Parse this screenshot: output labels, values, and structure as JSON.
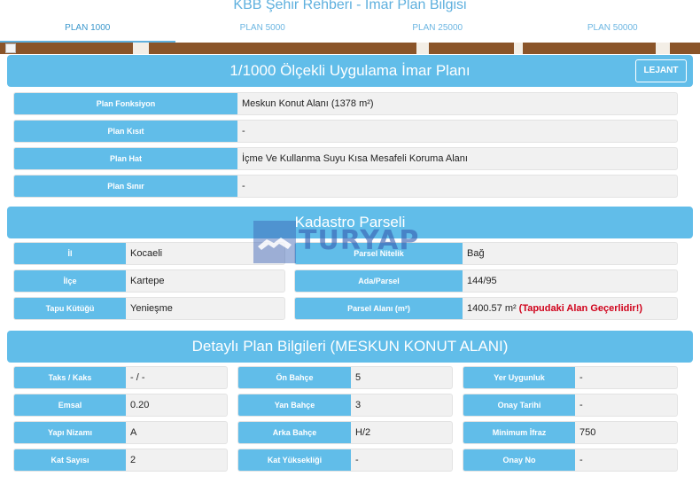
{
  "title": "KBB Şehir Rehberi - İmar Plan Bilgisi",
  "tabs": [
    "PLAN 1000",
    "PLAN 5000",
    "PLAN 25000",
    "PLAN 50000"
  ],
  "plan_section": {
    "title": "1/1000 Ölçekli Uygulama İmar Planı",
    "legend_button": "LEJANT",
    "rows": [
      {
        "label": "Plan Fonksiyon",
        "value": "Meskun Konut Alanı (1378 m²)"
      },
      {
        "label": "Plan Kısıt",
        "value": "-"
      },
      {
        "label": "Plan Hat",
        "value": "İçme Ve Kullanma Suyu Kısa Mesafeli Koruma Alanı"
      },
      {
        "label": "Plan Sınır",
        "value": "-"
      }
    ]
  },
  "cadastre_section": {
    "title": "Kadastro Parseli",
    "left": [
      {
        "label": "İl",
        "value": "Kocaeli"
      },
      {
        "label": "İlçe",
        "value": "Kartepe"
      },
      {
        "label": "Tapu Kütüğü",
        "value": "Yenieşme"
      }
    ],
    "right": [
      {
        "label": "Parsel Nitelik",
        "value": "Bağ"
      },
      {
        "label": "Ada/Parsel",
        "value": "144/95"
      },
      {
        "label": "Parsel Alanı (m²)",
        "value": "1400.57 m²",
        "note": "(Tapudaki Alan Geçerlidir!)"
      }
    ]
  },
  "detail_section": {
    "title": "Detaylı Plan Bilgileri (MESKUN KONUT ALANI)",
    "col1": [
      {
        "label": "Taks / Kaks",
        "value": "- / -"
      },
      {
        "label": "Emsal",
        "value": "0.20"
      },
      {
        "label": "Yapı Nizamı",
        "value": "A"
      },
      {
        "label": "Kat Sayısı",
        "value": "2"
      }
    ],
    "col2": [
      {
        "label": "Ön Bahçe",
        "value": "5"
      },
      {
        "label": "Yan Bahçe",
        "value": "3"
      },
      {
        "label": "Arka Bahçe",
        "value": "H/2"
      },
      {
        "label": "Kat Yüksekliği",
        "value": "-"
      }
    ],
    "col3": [
      {
        "label": "Yer Uygunluk",
        "value": "-"
      },
      {
        "label": "Onay Tarihi",
        "value": "-"
      },
      {
        "label": "Minimum İfraz",
        "value": "750"
      },
      {
        "label": "Onay No",
        "value": "-"
      }
    ]
  },
  "watermark": {
    "text": "TURYAP",
    "icon": "handshake-icon"
  },
  "colors": {
    "accent": "#61bde9",
    "tab_text": "#6cb6e2",
    "warning": "#d0021b",
    "map": "#8a5429"
  }
}
